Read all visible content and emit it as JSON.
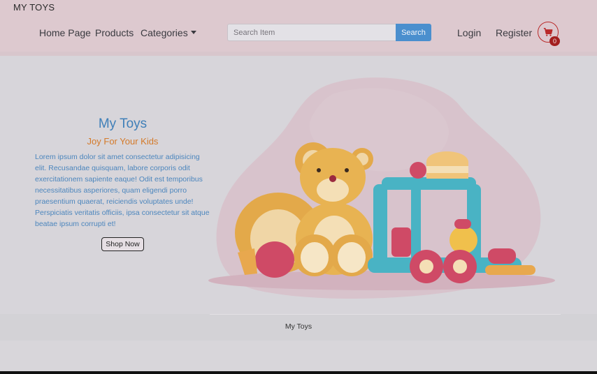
{
  "header": {
    "brand": "MY TOYS",
    "nav": {
      "home": "Home Page",
      "products": "Products",
      "categories": "Categories"
    },
    "search": {
      "placeholder": "Search Item",
      "button": "Search"
    },
    "login": "Login",
    "register": "Register",
    "cart_count": "0"
  },
  "hero": {
    "title": "My Toys",
    "subtitle": "Joy For Your Kids",
    "text": "Lorem ipsum dolor sit amet consectetur adipisicing elit. Recusandae quisquam, labore corporis odit exercitationem sapiente eaque! Odit est temporibus necessitatibus asperiores, quam eligendi porro praesentium quaerat, reiciendis voluptates unde! Perspiciatis veritatis officiis, ipsa consectetur sit atque beatae ipsum corrupti et!",
    "button": "Shop Now"
  },
  "footer": {
    "text": "My Toys"
  },
  "colors": {
    "header_bg": "#ddc9cf",
    "search_button": "#4a8fce",
    "title": "#3f7fb8",
    "subtitle": "#d47a2a",
    "cart": "#b92a2a"
  },
  "icons": {
    "cart": "shopping-cart-icon",
    "dropdown": "caret-down-icon"
  }
}
